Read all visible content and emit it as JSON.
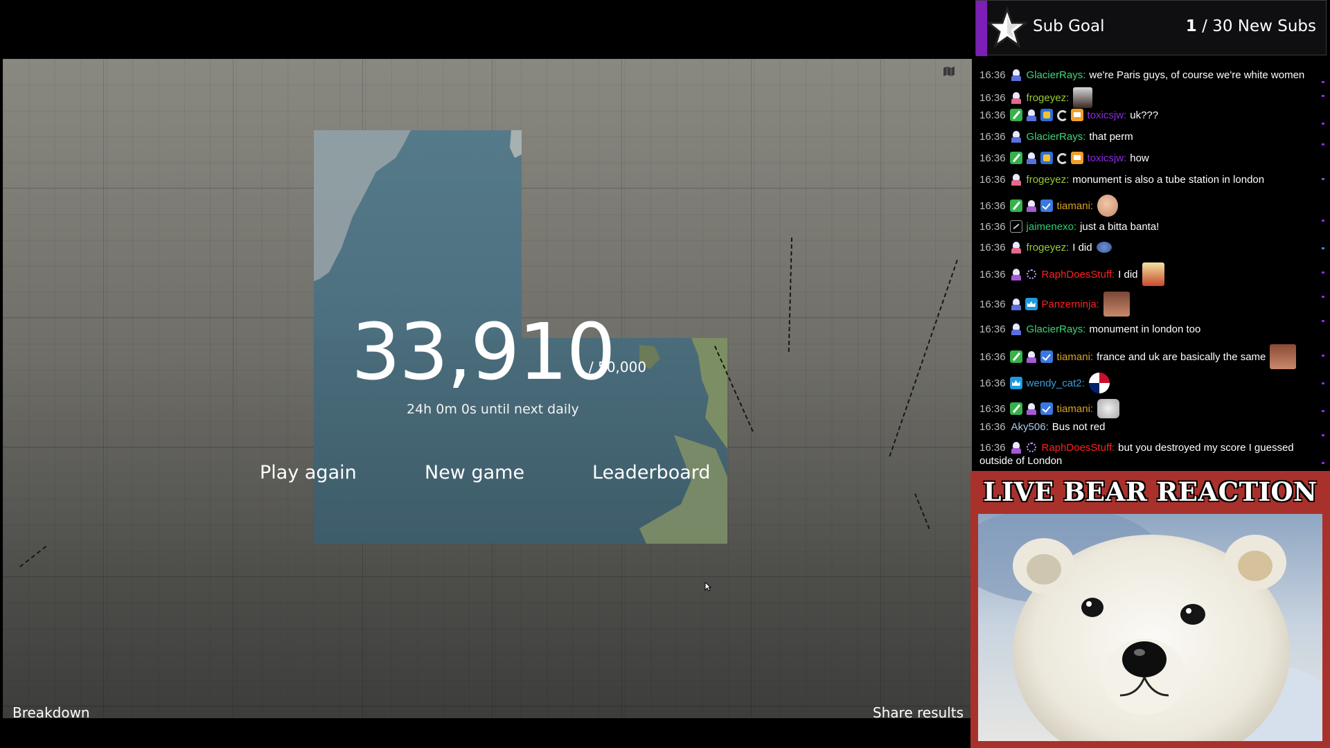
{
  "game": {
    "score": "33,910",
    "score_max": "/ 50,000",
    "countdown": "24h 0m 0s until next daily",
    "play_again": "Play again",
    "new_game": "New game",
    "leaderboard": "Leaderboard",
    "breakdown": "Breakdown",
    "share_results": "Share results"
  },
  "sub_goal": {
    "label": "Sub Goal",
    "current": "1",
    "target": " / 30 New Subs"
  },
  "chat": {
    "messages": [
      {
        "time": "16:36",
        "user": "GlacierRays:",
        "text": "we're Paris guys, of course we're white women",
        "color": "#3fd67b"
      },
      {
        "time": "16:36",
        "user": "frogeyez:",
        "text": "",
        "color": "#9acd32"
      },
      {
        "time": "16:36",
        "user": "toxicsjw:",
        "text": "uk???",
        "color": "#8a2be2"
      },
      {
        "time": "16:36",
        "user": "GlacierRays:",
        "text": "that perm",
        "color": "#3fd67b"
      },
      {
        "time": "16:36",
        "user": "toxicsjw:",
        "text": "how",
        "color": "#8a2be2"
      },
      {
        "time": "16:36",
        "user": "frogeyez:",
        "text": "monument is also a tube station in london",
        "color": "#9acd32"
      },
      {
        "time": "16:36",
        "user": "tiamani:",
        "text": "",
        "color": "#daa520"
      },
      {
        "time": "16:36",
        "user": "jaimenexo:",
        "text": "just a bitta banta!",
        "color": "#2ecc71"
      },
      {
        "time": "16:36",
        "user": "frogeyez:",
        "text": "I did",
        "color": "#9acd32"
      },
      {
        "time": "16:36",
        "user": "RaphDoesStuff:",
        "text": "I did",
        "color": "#ff2020"
      },
      {
        "time": "16:36",
        "user": "Panzerninja:",
        "text": "",
        "color": "#ff2020"
      },
      {
        "time": "16:36",
        "user": "GlacierRays:",
        "text": "monument in london too",
        "color": "#3fd67b"
      },
      {
        "time": "16:36",
        "user": "tiamani:",
        "text": "france and uk are basically the same",
        "color": "#daa520"
      },
      {
        "time": "16:36",
        "user": "wendy_cat2:",
        "text": "",
        "color": "#3a9fd8"
      },
      {
        "time": "16:36",
        "user": "tiamani:",
        "text": "",
        "color": "#daa520"
      },
      {
        "time": "16:36",
        "user": "Aky506:",
        "text": "Bus not red",
        "color": "#a8c8e8"
      },
      {
        "time": "16:36",
        "user": "RaphDoesStuff:",
        "text": "but you destroyed my score I guessed",
        "color": "#ff2020"
      },
      {
        "time": "",
        "user": "",
        "text": "outside of London",
        "color": "#ffffff"
      }
    ]
  },
  "bear": {
    "title": "LIVE BEAR REACTION"
  },
  "icons": {
    "star": "star-icon",
    "map_toggle": "map-icon",
    "cursor": "cursor-icon"
  },
  "colors": {
    "accent_purple": "#7c1fb6",
    "bear_panel": "#a9312c"
  }
}
